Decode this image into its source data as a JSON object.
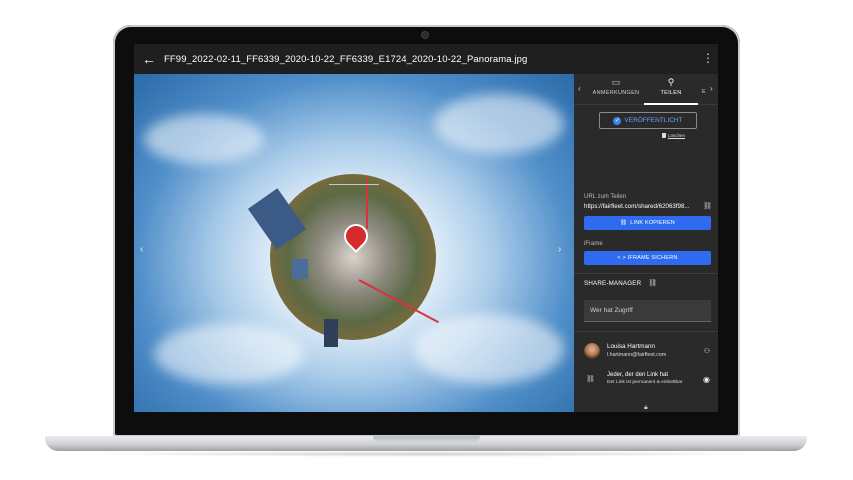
{
  "titlebar": {
    "back_icon": "arrow-left-icon",
    "file_title": "FF99_2022-02-11_FF6339_2020-10-22_FF6339_E1724_2020-10-22_Panorama.jpg",
    "more_icon": "more-vertical-icon"
  },
  "viewer": {
    "prev_icon": "chevron-left-icon",
    "next_icon": "chevron-right-icon",
    "pin_icon": "location-pin-icon"
  },
  "panel": {
    "tabs": [
      {
        "label": "ANMERKUNGEN",
        "icon": "comment-icon"
      },
      {
        "label": "TEILEN",
        "icon": "person-add-icon"
      },
      {
        "label": "E",
        "icon": ""
      }
    ],
    "status_label": "VERÖFFENTLICHT",
    "delete_label": "Löschen",
    "url_label": "URL zum Teilen",
    "url_value": "https://fairfleet.com/shared/62063f98...",
    "copy_link_label": "LINK KOPIEREN",
    "iframe_label": "iFrame",
    "iframe_button_label": "< > IFRAME SICHERN",
    "share_manager_label": "SHARE-MANAGER",
    "access_placeholder": "Wer hat Zugriff",
    "user": {
      "name": "Louisa Hartmann",
      "email": "l.hartmann@fairfleet.com"
    },
    "link_access": {
      "title": "Jeder, der den Link hat",
      "description": "Der Link ist permanent & einbettbar"
    }
  },
  "colors": {
    "accent": "#2f6bf0",
    "panel_bg": "#2a2a2a",
    "title_bg": "#1f1f1f"
  }
}
